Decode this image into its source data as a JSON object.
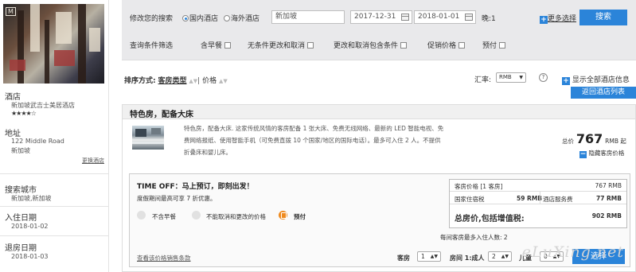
{
  "sidebar": {
    "hotel_label": "酒店",
    "hotel_name": "新加坡武吉士美居酒店",
    "hotel_stars": "★★★★☆",
    "address_label": "地址",
    "address_line1": "122 Middle Road",
    "address_line2": "新加坡",
    "change_hotel_link": "更换酒店",
    "city_label": "搜索城市",
    "city_value": "新加坡,新加坡",
    "checkin_label": "入住日期",
    "checkin_value": "2018-01-02",
    "checkout_label": "退房日期",
    "checkout_value": "2018-01-03"
  },
  "search": {
    "modify_label": "修改您的搜索",
    "radio_domestic": "国内酒店",
    "radio_overseas": "海外酒店",
    "destination_value": "新加坡",
    "checkin_value": "2017-12-31",
    "checkout_value": "2018-01-01",
    "nights_text": "晚:1",
    "more_options": "更多选择",
    "search_button": "搜索",
    "filter_label": "查询条件筛选",
    "filters": [
      "含早餐",
      "无条件更改和取消",
      "更改和取消包含条件",
      "促销价格",
      "预付"
    ]
  },
  "sort": {
    "label": "排序方式:",
    "by_room_type": "客房类型",
    "by_price": "价格",
    "currency_label": "汇率:",
    "currency_value": "RMB",
    "help_icon": "?",
    "show_all_info": "显示全部酒店信息",
    "return_list": "返回酒店列表"
  },
  "room": {
    "title": "特色房，配备大床",
    "description_line1": "特色房，配备大床. 这家传统风情的客房配备 1 张大床、免费无线网络、最新的 LED 智能电视、免",
    "description_line2": "费网络报纸、使用智能手机（可免费直拨 10 个国家/地区的国际电话）。最多可入住 2 人。不提供",
    "description_line3": "折叠床和婴儿床。",
    "total_label": "总价",
    "price": "767",
    "price_unit": "RMB 起",
    "hide_types": "隐藏客房价格"
  },
  "offer": {
    "title": "TIME OFF：马上预订，即刻出发！",
    "subtitle": "度假期间最高可享 7 折优惠。",
    "conditions": [
      "不含早餐",
      "不能取消和更改的价格",
      "预付"
    ],
    "price_table": {
      "room_price_label": "客房价格 [1 客房]",
      "room_price_value": "767 RMB",
      "tax_label": "国家住宿税",
      "tax_value": "59 RMB",
      "service_label": "酒店服务费",
      "service_value": "77 RMB",
      "total_label": "总房价,包括增值税:",
      "total_value": "902 RMB"
    },
    "max_guests": "每间客房最多入住人数: 2",
    "terms_link": "查看该价格销售条款",
    "rooms_label": "客房",
    "rooms_value": "1",
    "room_index_label": "房间 1:成人",
    "adults_value": "2",
    "children_label": "儿童",
    "children_value": "0",
    "select_button": "选择"
  },
  "watermark": "eLuXing.net",
  "colors": {
    "accent": "#2b84d9",
    "panel": "#e9e9eb",
    "orange": "#ef8a1e"
  }
}
